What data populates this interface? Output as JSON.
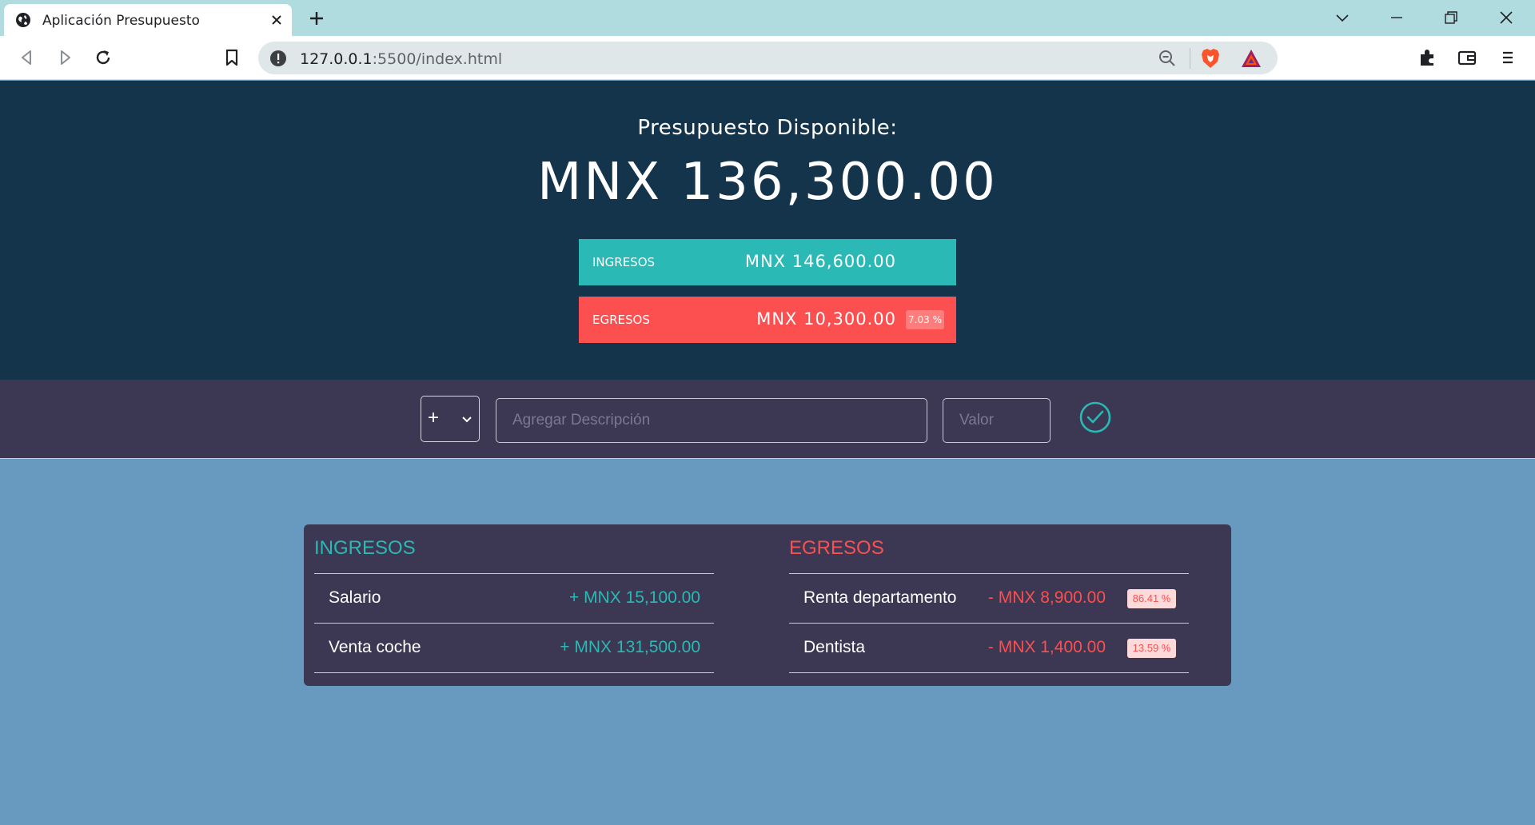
{
  "browser": {
    "tab_title": "Aplicación Presupuesto",
    "url_host": "127.0.0.1",
    "url_path": ":5500/index.html",
    "icons": [
      "globe-icon",
      "close-icon",
      "plus-icon",
      "chevron-down-icon",
      "minimize-icon",
      "restore-icon",
      "back-icon",
      "forward-icon",
      "reload-icon",
      "bookmark-icon",
      "info-icon",
      "zoom-out-icon",
      "brave-shield-icon",
      "bat-rewards-icon",
      "extensions-icon",
      "wallet-icon",
      "menu-icon"
    ]
  },
  "header": {
    "title": "Presupuesto Disponible:",
    "available": "MNX 136,300.00",
    "income_label": "INGRESOS",
    "income_total": "MNX 146,600.00",
    "expense_label": "EGRESOS",
    "expense_total": "MNX 10,300.00",
    "expense_percent": "7.03 %"
  },
  "form": {
    "type_value": "+",
    "description_placeholder": "Agregar Descripción",
    "value_placeholder": "Valor",
    "confirm_icon": "check-circle-icon"
  },
  "income": {
    "title": "INGRESOS",
    "items": [
      {
        "description": "Salario",
        "value": "+ MNX 15,100.00"
      },
      {
        "description": "Venta coche",
        "value": "+ MNX 131,500.00"
      }
    ]
  },
  "expenses": {
    "title": "EGRESOS",
    "items": [
      {
        "description": "Renta departamento",
        "value": "- MNX 8,900.00",
        "percent": "86.41 %"
      },
      {
        "description": "Dentista",
        "value": "- MNX 1,400.00",
        "percent": "13.59 %"
      }
    ]
  },
  "colors": {
    "header_bg": "#14344c",
    "income": "#2ab9b4",
    "expense": "#fc5050",
    "panel": "#3c3752",
    "page_bg": "#6899be"
  }
}
